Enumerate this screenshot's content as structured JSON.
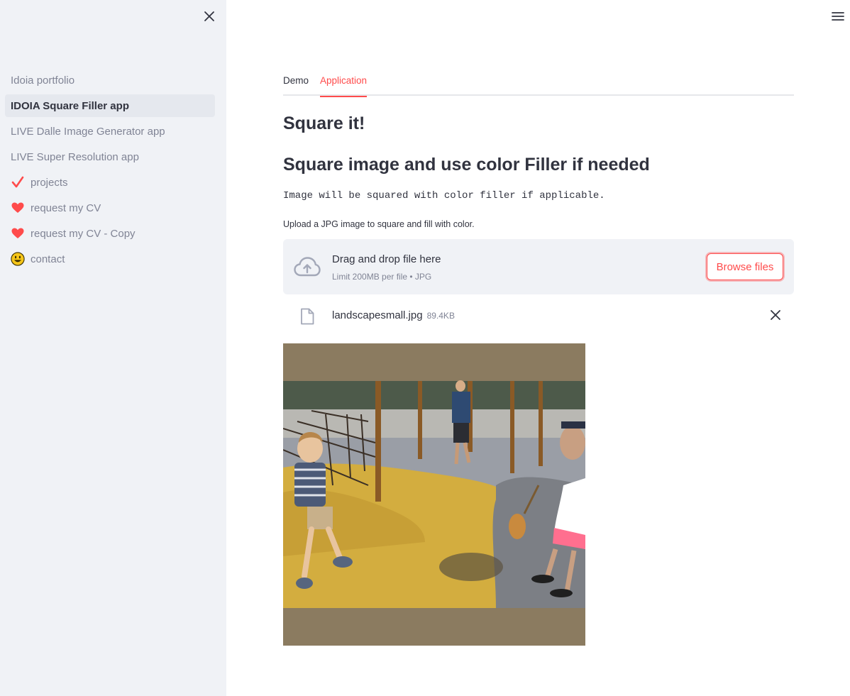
{
  "sidebar": {
    "items": [
      {
        "label": "Idoia portfolio",
        "icon": "",
        "active": false
      },
      {
        "label": "IDOIA Square Filler app",
        "icon": "",
        "active": true
      },
      {
        "label": "LIVE Dalle Image Generator app",
        "icon": "",
        "active": false
      },
      {
        "label": "LIVE Super Resolution app",
        "icon": "",
        "active": false
      },
      {
        "label": "projects",
        "icon": "check-icon",
        "active": false
      },
      {
        "label": "request my CV",
        "icon": "heart-icon",
        "active": false
      },
      {
        "label": "request my CV - Copy",
        "icon": "heart-icon",
        "active": false
      },
      {
        "label": "contact",
        "icon": "smiley-icon",
        "active": false
      }
    ]
  },
  "tabs": [
    {
      "label": "Demo",
      "active": false
    },
    {
      "label": "Application",
      "active": true
    }
  ],
  "main": {
    "title": "Square it!",
    "subtitle": "Square image and use color Filler if needed",
    "description": "Image will be squared with color filler if applicable.",
    "upload_label": "Upload a JPG image to square and fill with color."
  },
  "uploader": {
    "drag_text": "Drag and drop file here",
    "limit_text": "Limit 200MB per file • JPG",
    "browse_label": "Browse files"
  },
  "file": {
    "name": "landscapesmall.jpg",
    "size": "89.4KB"
  },
  "colors": {
    "accent": "#ff4b4b",
    "sidebar_bg": "#f0f2f6",
    "filler": "#8b7b60"
  }
}
